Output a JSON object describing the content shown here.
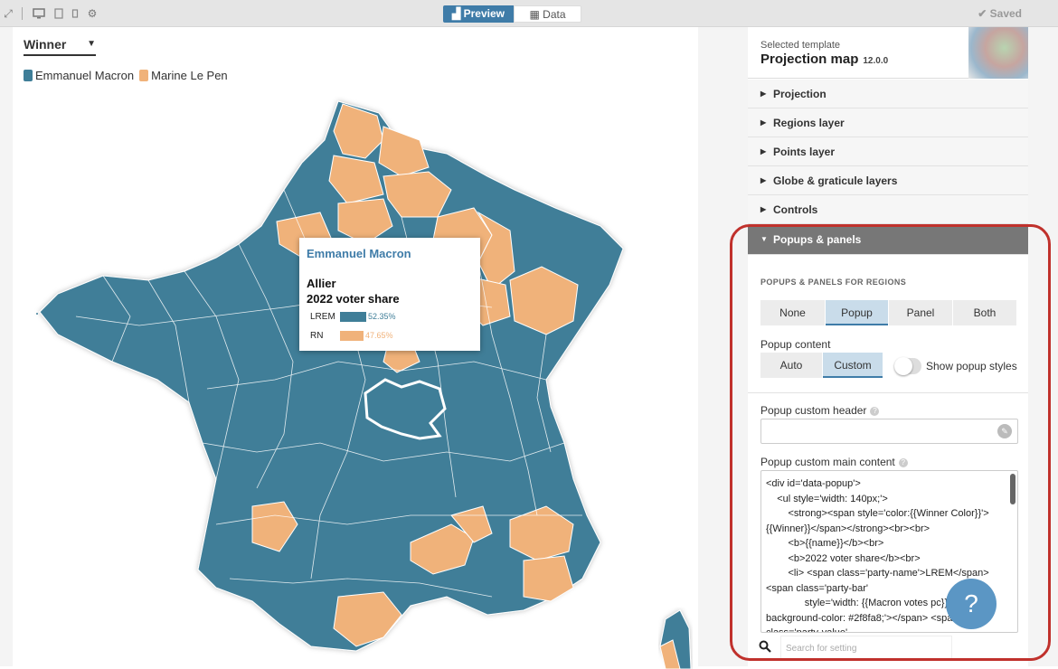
{
  "toolbar": {
    "preview_label": "Preview",
    "data_label": "Data",
    "saved_label": "Saved"
  },
  "canvas": {
    "winner_select": "Winner",
    "legend": [
      {
        "label": "Emmanuel Macron",
        "color": "#3f7e98"
      },
      {
        "label": "Marine Le Pen",
        "color": "#f0b27a"
      }
    ],
    "popup": {
      "header": "Emmanuel Macron",
      "name": "Allier",
      "subtitle": "2022 voter share",
      "rows": [
        {
          "party": "LREM",
          "value": "52.35%",
          "share": 52.35,
          "color": "#3f7e98"
        },
        {
          "party": "RN",
          "value": "47.65%",
          "share": 47.65,
          "color": "#f0b27a"
        }
      ]
    }
  },
  "sidebar": {
    "template_selected_label": "Selected template",
    "template_name": "Projection map",
    "template_version": "12.0.0",
    "sections": [
      {
        "label": "Projection"
      },
      {
        "label": "Regions layer"
      },
      {
        "label": "Points layer"
      },
      {
        "label": "Globe & graticule layers"
      },
      {
        "label": "Controls"
      },
      {
        "label": "Popups & panels"
      }
    ],
    "popups_title": "POPUPS & PANELS FOR REGIONS",
    "mode_buttons": [
      "None",
      "Popup",
      "Panel",
      "Both"
    ],
    "mode_selected": "Popup",
    "popup_content_label": "Popup content",
    "content_buttons": [
      "Auto",
      "Custom"
    ],
    "content_selected": "Custom",
    "show_styles_label": "Show popup styles",
    "header_label": "Popup custom header",
    "main_label": "Popup custom main content",
    "code": "<div id='data-popup'>\n    <ul style='width: 140px;'>\n        <strong><span style='color:{{Winner Color}}'>{{Winner}}</span></strong><br><br>\n        <b>{{name}}</b><br>\n        <b>2022 voter share</b><br>\n        <li> <span class='party-name'>LREM</span> <span class='party-bar'\n              style='width: {{Macron votes pc}}; background-color: #2f8fa8;'></span> <span class='party-value'",
    "search_placeholder": "Search for setting"
  },
  "colors": {
    "macron": "#3f7e98",
    "lepen": "#f0b27a",
    "accent": "#3f7ca8",
    "highlight": "#c0312c"
  }
}
